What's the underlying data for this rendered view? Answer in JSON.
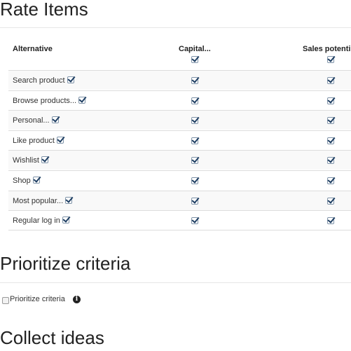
{
  "sections": {
    "rate_items": "Rate Items",
    "prioritize_criteria": "Prioritize criteria",
    "collect_ideas": "Collect ideas"
  },
  "table": {
    "headers": {
      "alternative": "Alternative",
      "col1": "Capital...",
      "col2": "Sales potenti"
    },
    "rows": [
      {
        "label": "Search product"
      },
      {
        "label": "Browse products..."
      },
      {
        "label": "Personal..."
      },
      {
        "label": "Like product"
      },
      {
        "label": "Wishlist"
      },
      {
        "label": "Shop"
      },
      {
        "label": "Most popular..."
      },
      {
        "label": "Regular log in"
      }
    ]
  },
  "prioritize": {
    "checkbox_label": "Prioritize criteria",
    "checked": false,
    "info_icon": "info-circle-icon"
  }
}
